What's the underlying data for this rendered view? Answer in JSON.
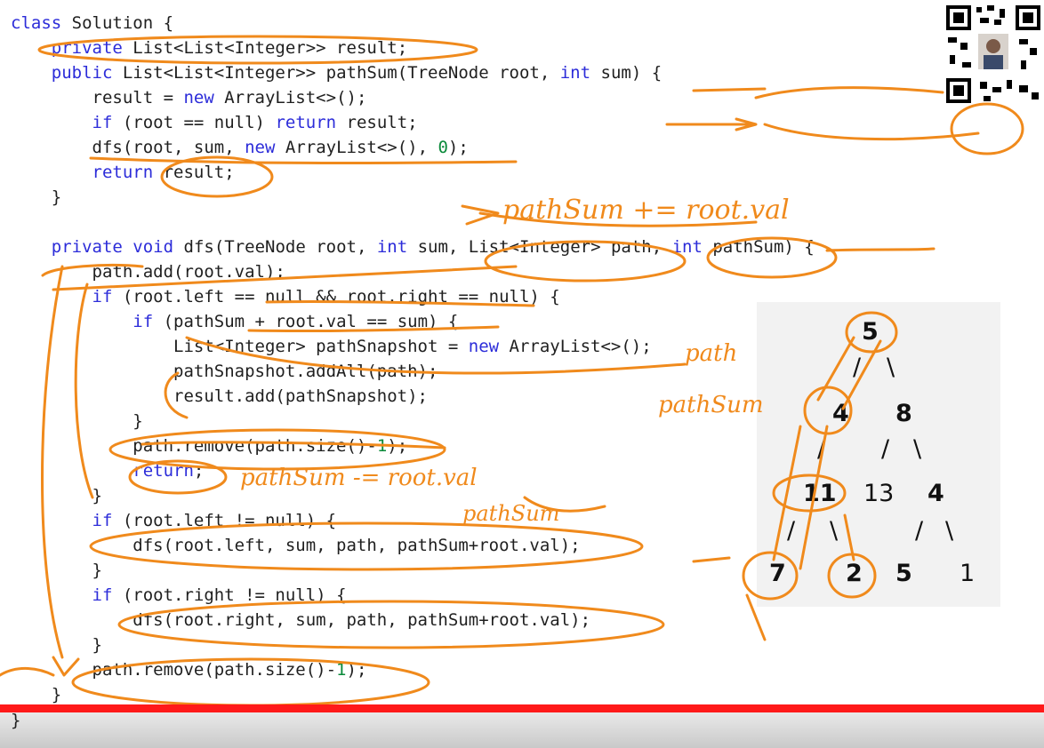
{
  "code_lines": [
    "class Solution {",
    "    private List<List<Integer>> result;",
    "    public List<List<Integer>> pathSum(TreeNode root, int sum) {",
    "        result = new ArrayList<>();",
    "        if (root == null) return result;",
    "        dfs(root, sum, new ArrayList<>(), 0);",
    "        return result;",
    "    }",
    "",
    "    private void dfs(TreeNode root, int sum, List<Integer> path, int pathSum) {",
    "        path.add(root.val);",
    "        if (root.left == null && root.right == null) {",
    "            if (pathSum + root.val == sum) {",
    "                List<Integer> pathSnapshot = new ArrayList<>();",
    "                pathSnapshot.addAll(path);",
    "                result.add(pathSnapshot);",
    "            }",
    "            path.remove(path.size()-1);",
    "            return;",
    "        }",
    "        if (root.left != null) {",
    "            dfs(root.left, sum, path, pathSum+root.val);",
    "        }",
    "        if (root.right != null) {",
    "            dfs(root.right, sum, path, pathSum+root.val);",
    "        }",
    "        path.remove(path.size()-1);",
    "    }",
    "}"
  ],
  "tree": {
    "nodes": [
      "5",
      "4",
      "8",
      "11",
      "13",
      "4",
      "7",
      "2",
      "5",
      "1"
    ],
    "edges": [
      "/",
      "\\",
      "/",
      "/",
      "\\",
      "/",
      "\\",
      "/",
      "\\"
    ]
  },
  "annotations": {
    "pathsum_update": "pathSum += root.val",
    "path": "path",
    "pathsum_label": "pathSum",
    "pathsum_minus": "pathSum -= root.val",
    "pathsum_bottom": "pathSum"
  },
  "colors": {
    "keyword": "#2c2cd9",
    "number": "#0a8a3a",
    "ink": "#f08a1c",
    "progress": "#ff1a1a"
  }
}
